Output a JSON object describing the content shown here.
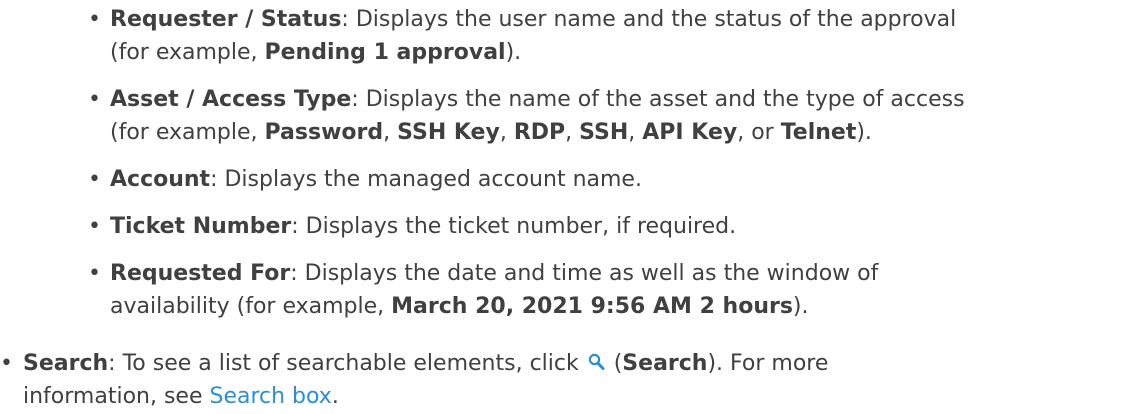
{
  "bullet": "•",
  "items": [
    {
      "term": "Requester / Status",
      "line1": ": Displays the user name and the status of the approval",
      "line2_pre": "(for example, ",
      "example": "Pending 1 approval",
      "line2_post": ")."
    },
    {
      "term": "Asset / Access Type",
      "line1": ": Displays the name of the asset and the type of access",
      "line2_pre": "(for example, ",
      "ex1": "Password",
      "sep1": ", ",
      "ex2": "SSH Key",
      "sep2": ", ",
      "ex3": "RDP",
      "sep3": ", ",
      "ex4": "SSH",
      "sep4": ", ",
      "ex5": "API Key",
      "sep5": ", or ",
      "ex6": "Telnet",
      "line2_post": ")."
    },
    {
      "term": "Account",
      "text": ": Displays the managed account name."
    },
    {
      "term": "Ticket Number",
      "text": ": Displays the ticket number, if required."
    },
    {
      "term": "Requested For",
      "line1": ": Displays the date and time as well as the window of",
      "line2_pre": "availability (for example, ",
      "example": "March 20, 2021 9:56 AM 2 hours",
      "line2_post": ")."
    }
  ],
  "search": {
    "term": "Search",
    "text1": ": To see a list of searchable elements, click ",
    "paren_open": " (",
    "icon_label": "Search",
    "text2": "). For more",
    "text3": "information, see ",
    "link": "Search box",
    "end": "."
  },
  "colors": {
    "text": "#404040",
    "link": "#2b8fd6",
    "icon": "#2b8fd6"
  },
  "icons": [
    "search-icon"
  ]
}
